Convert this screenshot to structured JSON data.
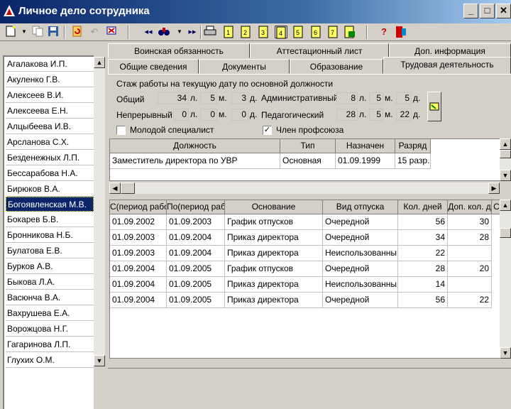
{
  "window": {
    "title": "Личное дело сотрудника",
    "minimize": "_",
    "maximize": "□",
    "close": "✕"
  },
  "employees": [
    "Агалакова И.П.",
    "Акуленко Г.В.",
    "Алексеев В.И.",
    "Алексеева Е.Н.",
    "Алцыбеева И.В.",
    "Арсланова С.Х.",
    "Безденежных Л.П.",
    "Бессарабова Н.А.",
    "Бирюков В.А.",
    "Богоявленская М.В.",
    "Бокарев Б.В.",
    "Бронникова Н.Б.",
    "Булатова Е.В.",
    "Бурков А.В.",
    "Быкова Л.А.",
    "Васюнча В.А.",
    "Вахрушева Е.А.",
    "Ворожцова Н.Г.",
    "Гагаринова Л.П.",
    "Глухих О.М."
  ],
  "selected_employee": "Богоявленская М.В.",
  "tabs_row1": [
    "Воинская обязанность",
    "Аттестационный лист",
    "Доп. информация"
  ],
  "tabs_row2": [
    "Общие сведения",
    "Документы",
    "Образование",
    "Трудовая деятельность"
  ],
  "active_tab": "Трудовая деятельность",
  "experience": {
    "group_title": "Стаж работы на текущую дату по основной должности",
    "total_label": "Общий",
    "continuous_label": "Непрерывный",
    "admin_label": "Административный",
    "ped_label": "Педагогический",
    "unit_years": "л.",
    "unit_months": "м.",
    "unit_days": "д.",
    "total": [
      "34",
      "5",
      "3"
    ],
    "continuous": [
      "0",
      "0",
      "0"
    ],
    "admin": [
      "8",
      "5",
      "5"
    ],
    "ped": [
      "28",
      "5",
      "22"
    ]
  },
  "young_specialist_label": "Молодой специалист",
  "union_member_label": "Член профсоюза",
  "union_check": "✓",
  "positions": {
    "headers": [
      "Должность",
      "Тип",
      "Назначен",
      "Разряд"
    ],
    "rows": [
      [
        "Заместитель директора по УВР",
        "Основная",
        "01.09.1999",
        "15 разр."
      ]
    ]
  },
  "vacations": {
    "headers": [
      "С(период работ",
      "По(период раб",
      "Основание",
      "Вид отпуска",
      "Кол. дней",
      "Доп. кол. д",
      "С"
    ],
    "rows": [
      [
        "01.09.2002",
        "01.09.2003",
        "График отпусков",
        "Очередной",
        "56",
        "30"
      ],
      [
        "01.09.2003",
        "01.09.2004",
        "Приказ директора",
        "Очередной",
        "34",
        "28"
      ],
      [
        "01.09.2003",
        "01.09.2004",
        "Приказ директора",
        "Неиспользованны",
        "22",
        ""
      ],
      [
        "01.09.2004",
        "01.09.2005",
        "График отпусков",
        "Очередной",
        "28",
        "20"
      ],
      [
        "01.09.2004",
        "01.09.2005",
        "Приказ директора",
        "Неиспользованны",
        "14",
        ""
      ],
      [
        "01.09.2004",
        "01.09.2005",
        "Приказ директора",
        "Очередной",
        "56",
        "22"
      ]
    ]
  },
  "toolbar_icons": [
    "new-doc-icon",
    "dropdown-icon",
    "copy-icon",
    "save-icon",
    "refresh-icon",
    "undo-icon",
    "delete-icon",
    "first-icon",
    "find-icon",
    "dropdown-icon",
    "last-icon",
    "print-icon",
    "doc1-icon",
    "doc2-icon",
    "doc3-icon",
    "doc4-icon",
    "doc5-icon",
    "doc6-icon",
    "doc7-icon",
    "export-icon",
    "help-icon",
    "exit-icon"
  ],
  "colors": {
    "title_start": "#0a246a",
    "title_end": "#a6caf0",
    "selection": "#0a246a"
  }
}
